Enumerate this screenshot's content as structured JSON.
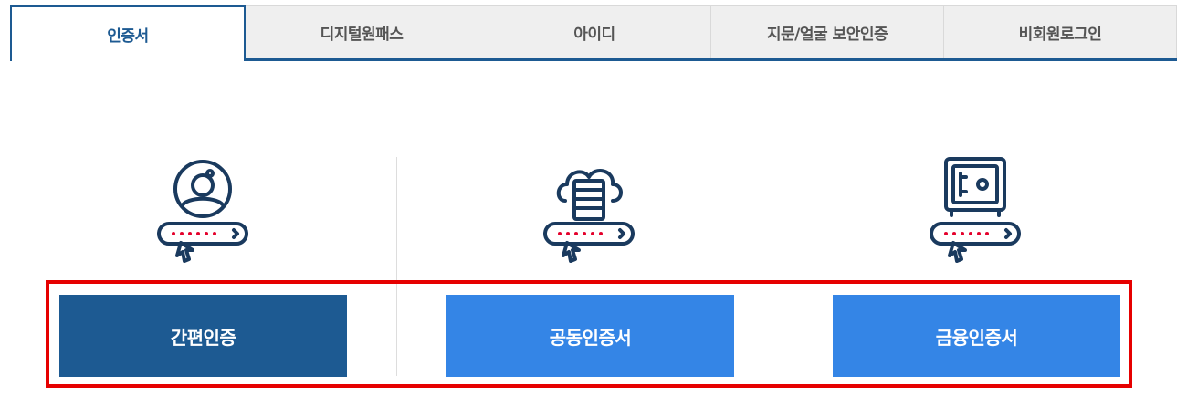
{
  "tabs": [
    {
      "label": "인증서",
      "active": true
    },
    {
      "label": "디지털원패스",
      "active": false
    },
    {
      "label": "아이디",
      "active": false
    },
    {
      "label": "지문/얼굴 보안인증",
      "active": false
    },
    {
      "label": "비회원로그인",
      "active": false
    }
  ],
  "options": [
    {
      "label": "간편인증",
      "icon": "user-key-icon",
      "color": "#1d5a92"
    },
    {
      "label": "공동인증서",
      "icon": "cloud-server-key-icon",
      "color": "#3485e6"
    },
    {
      "label": "금융인증서",
      "icon": "safe-key-icon",
      "color": "#3485e6"
    }
  ],
  "colors": {
    "accent": "#1d5a92",
    "button_light": "#3485e6",
    "highlight": "#e60000",
    "icon_stroke": "#1a3a5e",
    "password_dots": "#e4002b"
  }
}
